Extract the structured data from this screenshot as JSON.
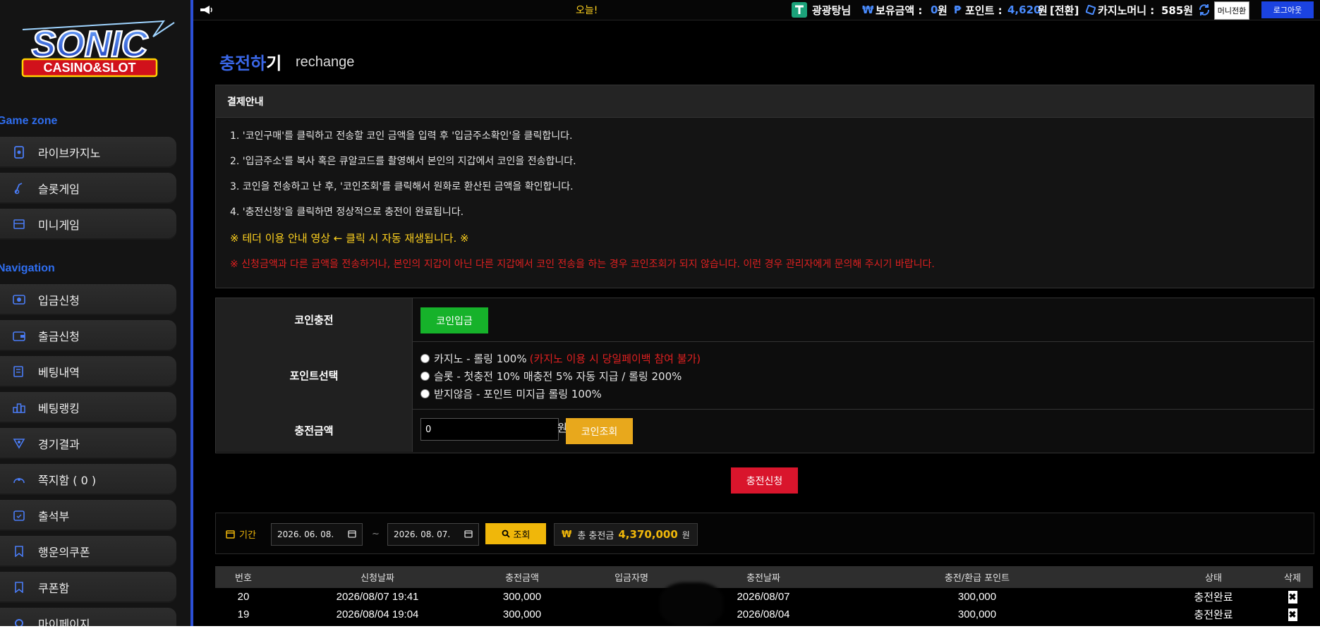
{
  "brand": {
    "logo_line1": "SONIC",
    "logo_line2": "CASINO&SLOT"
  },
  "colors": {
    "accent": "#2b4fd6",
    "green": "#16b22a",
    "orange": "#e8a81c",
    "red": "#d9152c",
    "yellow": "#f0b70a"
  },
  "sidebar": {
    "game_zone_label": "Game zone",
    "game_items": [
      {
        "label": "라이브카지노",
        "icon": "live-casino-icon"
      },
      {
        "label": "슬롯게임",
        "icon": "slot-icon"
      },
      {
        "label": "미니게임",
        "icon": "mini-game-icon"
      }
    ],
    "nav_label": "Navigation",
    "nav_items": [
      {
        "label": "입금신청",
        "icon": "deposit-icon"
      },
      {
        "label": "출금신청",
        "icon": "withdraw-icon"
      },
      {
        "label": "베팅내역",
        "icon": "bet-history-icon"
      },
      {
        "label": "베팅랭킹",
        "icon": "ranking-icon"
      },
      {
        "label": "경기결과",
        "icon": "trophy-icon"
      },
      {
        "label": "쪽지함 ( 0 )",
        "icon": "message-icon"
      },
      {
        "label": "출석부",
        "icon": "calendar-icon"
      },
      {
        "label": "행운의쿠폰",
        "icon": "coupon-icon"
      },
      {
        "label": "쿠폰함",
        "icon": "coupon-box-icon"
      },
      {
        "label": "마이페이지",
        "icon": "mypage-icon"
      }
    ]
  },
  "topbar": {
    "ticker": "오늘!",
    "username": "광광탕님",
    "balance_label": "보유금액 :",
    "balance_value": "0",
    "balance_unit": "원",
    "points_label": "포인트 :",
    "points_value": "4,620",
    "points_unit": "원",
    "convert_label": "[전환]",
    "casino_money_label": "카지노머니 :",
    "casino_money_value": "585원",
    "money_convert_btn": "머니전환",
    "logout_btn": "로그아웃"
  },
  "page": {
    "title_a": "충전하",
    "title_b": "기",
    "subtitle": "rechange"
  },
  "info": {
    "heading": "결제안내",
    "lines": [
      "1. '코인구매'를 클릭하고 전송할 코인 금액을 입력 후 '입금주소확인'을 클릭합니다.",
      "2. '입금주소'를 복사 혹은 큐알코드를 촬영해서 본인의 지갑에서 코인을 전송합니다.",
      "3. 코인을 전송하고 난 후, '코인조회'를 클릭해서 원화로 환산된 금액을 확인합니다.",
      "4. '충전신청'을 클릭하면 정상적으로 충전이 완료됩니다."
    ],
    "video_notice": "※ 테더 이용 안내 영상 ← 클릭 시 자동 재생됩니다. ※",
    "warning": "※ 신청금액과 다른 금액을 전송하거나, 본인의 지갑이 아닌 다른 지갑에서 코인 전송을 하는 경우 코인조회가 되지 않습니다. 이런 경우 관리자에게 문의해 주시기 바랍니다."
  },
  "form": {
    "coin_label": "코인충전",
    "coin_button": "코인입금",
    "point_label": "포인트선택",
    "options": [
      {
        "text": "카지노 - 롤링 100%",
        "note": "(카지노 이용 시 당일페이백 참여 불가)"
      },
      {
        "text": "슬롯 - 첫충전 10% 매충전 5% 자동 지급 / 롤링 200%",
        "note": ""
      },
      {
        "text": "받지않음 - 포인트 미지급 롤링 100%",
        "note": ""
      }
    ],
    "amount_label": "충전금액",
    "amount_value": "0",
    "won": "원",
    "coin_check_button": "코인조회",
    "submit_button": "충전신청"
  },
  "filter": {
    "period_label": "기간",
    "date_from": "2026. 06. 08.",
    "tilde": "~",
    "date_to": "2026. 08. 07.",
    "search_button": "조회",
    "total_label": "총 충전금",
    "total_value": "4,370,000",
    "total_unit": "원"
  },
  "table": {
    "headers": [
      "번호",
      "신청날짜",
      "충전금액",
      "입금자명",
      "충전날짜",
      "충전/환급 포인트",
      "상태",
      "삭제"
    ],
    "rows": [
      {
        "no": "20",
        "req_date": "2026/08/07 19:41",
        "amount": "300,000",
        "name": "",
        "charge_date": "2026/08/07",
        "points": "300,000",
        "status": "충전완료"
      },
      {
        "no": "19",
        "req_date": "2026/08/04 19:04",
        "amount": "300,000",
        "name": "",
        "charge_date": "2026/08/04",
        "points": "300,000",
        "status": "충전완료"
      }
    ]
  }
}
